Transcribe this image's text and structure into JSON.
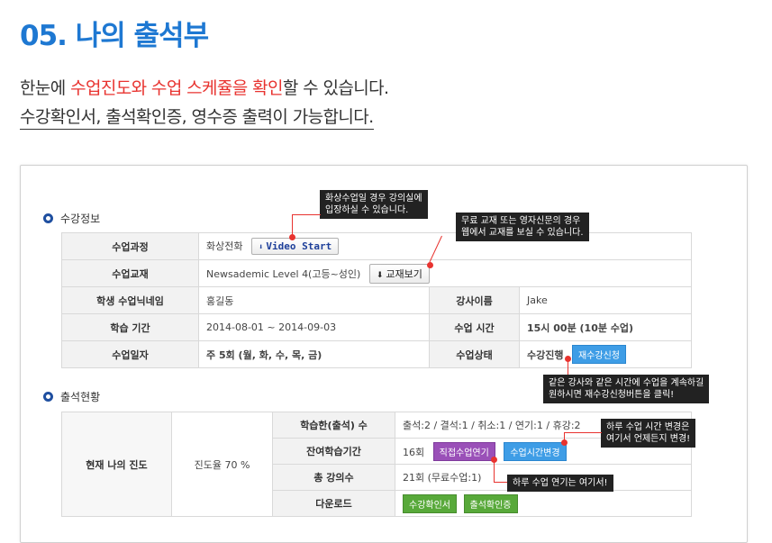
{
  "header": {
    "title": "05. 나의 출석부",
    "line1_pre": "한눈에 ",
    "line1_hl": "수업진도와 수업 스케쥴을 확인",
    "line1_post": "할 수 있습니다.",
    "line2": "수강확인서, 출석확인증, 영수증 출력이 가능합니다."
  },
  "course_info": {
    "section_title": "수강정보",
    "rows": {
      "course_label": "수업과정",
      "course_value": "화상전화",
      "video_button": "Video Start",
      "material_label": "수업교재",
      "material_value": "Newsademic Level 4(고등~성인)",
      "material_button": "교재보기",
      "nickname_label": "학생 수업닉네임",
      "nickname_value": "홍길동",
      "teacher_label": "강사이름",
      "teacher_value": "Jake",
      "period_label": "학습 기간",
      "period_value": "2014-08-01 ~ 2014-09-03",
      "time_label": "수업 시간",
      "time_value": "15시 00분 (10분 수업)",
      "days_label": "수업일자",
      "days_value": "주 5회 (월, 화, 수, 목, 금)",
      "status_label": "수업상태",
      "status_value": "수강진행",
      "reregister_button": "재수강신청"
    }
  },
  "attendance": {
    "section_title": "출석현황",
    "progress_label": "현재 나의 진도",
    "progress_value": "진도율 70 %",
    "progress_percent": 70,
    "rows": {
      "completed_label": "학습한(출석) 수",
      "completed_value": "출석:2 / 결석:1 / 취소:1 / 연기:1 / 휴강:2",
      "remaining_label": "잔여학습기간",
      "remaining_value": "16회",
      "postpone_button": "직접수업연기",
      "change_time_button": "수업시간변경",
      "total_label": "총 강의수",
      "total_value": "21회 (무료수업:1)",
      "download_label": "다운로드",
      "cert_button": "수강확인서",
      "attend_button": "출석확인증"
    }
  },
  "tooltips": {
    "video_tip": "화상수업일 경우 강의실에\n입장하실 수 있습니다.",
    "book_tip": "무료 교재 또는 영자신문의 경우\n웹에서 교재를 보실 수 있습니다.",
    "reregister_tip": "같은 강사와 같은 시간에 수업을 계속하길\n원하시면 재수강신청버튼을 클릭!",
    "change_tip": "하루 수업 시간 변경은\n여기서 언제든지 변경!",
    "postpone_tip": "하루 수업 연기는 여기서!"
  },
  "colors": {
    "title": "#1e78d2",
    "highlight": "#e8332f",
    "btn_blue": "#3e9de6",
    "btn_purple": "#9a50b8",
    "btn_green": "#58a93a"
  }
}
